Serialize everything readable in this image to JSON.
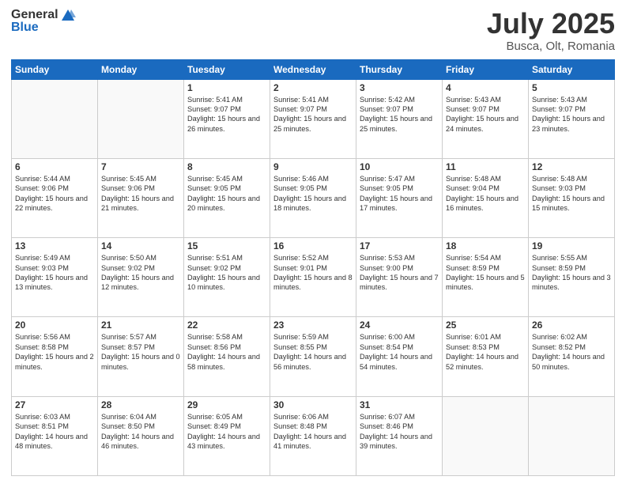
{
  "header": {
    "logo_general": "General",
    "logo_blue": "Blue",
    "month_title": "July 2025",
    "location": "Busca, Olt, Romania"
  },
  "weekdays": [
    "Sunday",
    "Monday",
    "Tuesday",
    "Wednesday",
    "Thursday",
    "Friday",
    "Saturday"
  ],
  "weeks": [
    [
      {
        "day": "",
        "sunrise": "",
        "sunset": "",
        "daylight": ""
      },
      {
        "day": "",
        "sunrise": "",
        "sunset": "",
        "daylight": ""
      },
      {
        "day": "1",
        "sunrise": "Sunrise: 5:41 AM",
        "sunset": "Sunset: 9:07 PM",
        "daylight": "Daylight: 15 hours and 26 minutes."
      },
      {
        "day": "2",
        "sunrise": "Sunrise: 5:41 AM",
        "sunset": "Sunset: 9:07 PM",
        "daylight": "Daylight: 15 hours and 25 minutes."
      },
      {
        "day": "3",
        "sunrise": "Sunrise: 5:42 AM",
        "sunset": "Sunset: 9:07 PM",
        "daylight": "Daylight: 15 hours and 25 minutes."
      },
      {
        "day": "4",
        "sunrise": "Sunrise: 5:43 AM",
        "sunset": "Sunset: 9:07 PM",
        "daylight": "Daylight: 15 hours and 24 minutes."
      },
      {
        "day": "5",
        "sunrise": "Sunrise: 5:43 AM",
        "sunset": "Sunset: 9:07 PM",
        "daylight": "Daylight: 15 hours and 23 minutes."
      }
    ],
    [
      {
        "day": "6",
        "sunrise": "Sunrise: 5:44 AM",
        "sunset": "Sunset: 9:06 PM",
        "daylight": "Daylight: 15 hours and 22 minutes."
      },
      {
        "day": "7",
        "sunrise": "Sunrise: 5:45 AM",
        "sunset": "Sunset: 9:06 PM",
        "daylight": "Daylight: 15 hours and 21 minutes."
      },
      {
        "day": "8",
        "sunrise": "Sunrise: 5:45 AM",
        "sunset": "Sunset: 9:05 PM",
        "daylight": "Daylight: 15 hours and 20 minutes."
      },
      {
        "day": "9",
        "sunrise": "Sunrise: 5:46 AM",
        "sunset": "Sunset: 9:05 PM",
        "daylight": "Daylight: 15 hours and 18 minutes."
      },
      {
        "day": "10",
        "sunrise": "Sunrise: 5:47 AM",
        "sunset": "Sunset: 9:05 PM",
        "daylight": "Daylight: 15 hours and 17 minutes."
      },
      {
        "day": "11",
        "sunrise": "Sunrise: 5:48 AM",
        "sunset": "Sunset: 9:04 PM",
        "daylight": "Daylight: 15 hours and 16 minutes."
      },
      {
        "day": "12",
        "sunrise": "Sunrise: 5:48 AM",
        "sunset": "Sunset: 9:03 PM",
        "daylight": "Daylight: 15 hours and 15 minutes."
      }
    ],
    [
      {
        "day": "13",
        "sunrise": "Sunrise: 5:49 AM",
        "sunset": "Sunset: 9:03 PM",
        "daylight": "Daylight: 15 hours and 13 minutes."
      },
      {
        "day": "14",
        "sunrise": "Sunrise: 5:50 AM",
        "sunset": "Sunset: 9:02 PM",
        "daylight": "Daylight: 15 hours and 12 minutes."
      },
      {
        "day": "15",
        "sunrise": "Sunrise: 5:51 AM",
        "sunset": "Sunset: 9:02 PM",
        "daylight": "Daylight: 15 hours and 10 minutes."
      },
      {
        "day": "16",
        "sunrise": "Sunrise: 5:52 AM",
        "sunset": "Sunset: 9:01 PM",
        "daylight": "Daylight: 15 hours and 8 minutes."
      },
      {
        "day": "17",
        "sunrise": "Sunrise: 5:53 AM",
        "sunset": "Sunset: 9:00 PM",
        "daylight": "Daylight: 15 hours and 7 minutes."
      },
      {
        "day": "18",
        "sunrise": "Sunrise: 5:54 AM",
        "sunset": "Sunset: 8:59 PM",
        "daylight": "Daylight: 15 hours and 5 minutes."
      },
      {
        "day": "19",
        "sunrise": "Sunrise: 5:55 AM",
        "sunset": "Sunset: 8:59 PM",
        "daylight": "Daylight: 15 hours and 3 minutes."
      }
    ],
    [
      {
        "day": "20",
        "sunrise": "Sunrise: 5:56 AM",
        "sunset": "Sunset: 8:58 PM",
        "daylight": "Daylight: 15 hours and 2 minutes."
      },
      {
        "day": "21",
        "sunrise": "Sunrise: 5:57 AM",
        "sunset": "Sunset: 8:57 PM",
        "daylight": "Daylight: 15 hours and 0 minutes."
      },
      {
        "day": "22",
        "sunrise": "Sunrise: 5:58 AM",
        "sunset": "Sunset: 8:56 PM",
        "daylight": "Daylight: 14 hours and 58 minutes."
      },
      {
        "day": "23",
        "sunrise": "Sunrise: 5:59 AM",
        "sunset": "Sunset: 8:55 PM",
        "daylight": "Daylight: 14 hours and 56 minutes."
      },
      {
        "day": "24",
        "sunrise": "Sunrise: 6:00 AM",
        "sunset": "Sunset: 8:54 PM",
        "daylight": "Daylight: 14 hours and 54 minutes."
      },
      {
        "day": "25",
        "sunrise": "Sunrise: 6:01 AM",
        "sunset": "Sunset: 8:53 PM",
        "daylight": "Daylight: 14 hours and 52 minutes."
      },
      {
        "day": "26",
        "sunrise": "Sunrise: 6:02 AM",
        "sunset": "Sunset: 8:52 PM",
        "daylight": "Daylight: 14 hours and 50 minutes."
      }
    ],
    [
      {
        "day": "27",
        "sunrise": "Sunrise: 6:03 AM",
        "sunset": "Sunset: 8:51 PM",
        "daylight": "Daylight: 14 hours and 48 minutes."
      },
      {
        "day": "28",
        "sunrise": "Sunrise: 6:04 AM",
        "sunset": "Sunset: 8:50 PM",
        "daylight": "Daylight: 14 hours and 46 minutes."
      },
      {
        "day": "29",
        "sunrise": "Sunrise: 6:05 AM",
        "sunset": "Sunset: 8:49 PM",
        "daylight": "Daylight: 14 hours and 43 minutes."
      },
      {
        "day": "30",
        "sunrise": "Sunrise: 6:06 AM",
        "sunset": "Sunset: 8:48 PM",
        "daylight": "Daylight: 14 hours and 41 minutes."
      },
      {
        "day": "31",
        "sunrise": "Sunrise: 6:07 AM",
        "sunset": "Sunset: 8:46 PM",
        "daylight": "Daylight: 14 hours and 39 minutes."
      },
      {
        "day": "",
        "sunrise": "",
        "sunset": "",
        "daylight": ""
      },
      {
        "day": "",
        "sunrise": "",
        "sunset": "",
        "daylight": ""
      }
    ]
  ]
}
